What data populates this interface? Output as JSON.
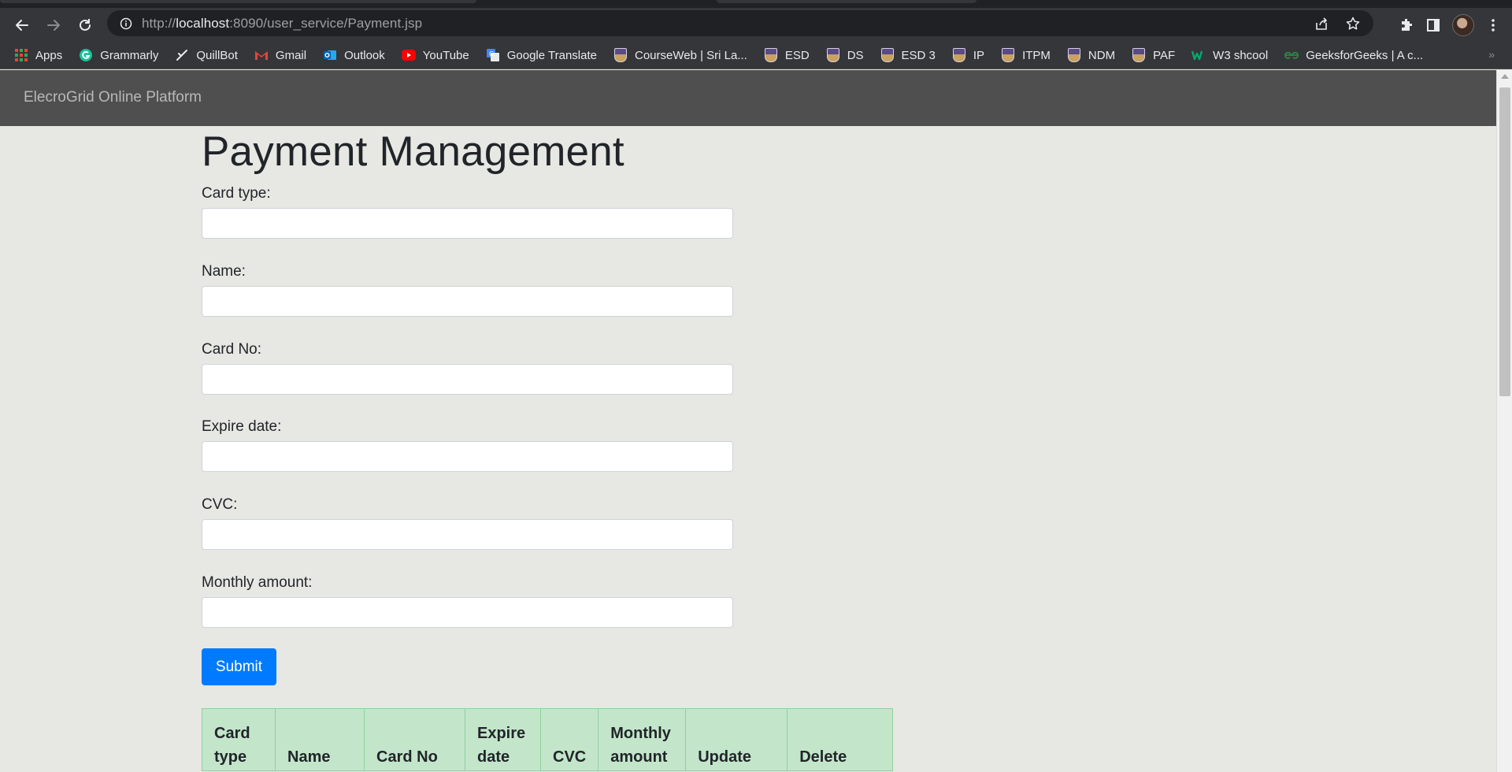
{
  "browser": {
    "url_prefix": "http://",
    "url_host": "localhost",
    "url_rest": ":8090/user_service/Payment.jsp",
    "bookmarks": [
      {
        "label": "Apps",
        "icon": "apps-grid-icon"
      },
      {
        "label": "Grammarly",
        "icon": "grammarly-icon"
      },
      {
        "label": "QuillBot",
        "icon": "quillbot-icon"
      },
      {
        "label": "Gmail",
        "icon": "gmail-icon"
      },
      {
        "label": "Outlook",
        "icon": "outlook-icon"
      },
      {
        "label": "YouTube",
        "icon": "youtube-icon"
      },
      {
        "label": "Google Translate",
        "icon": "google-translate-icon"
      },
      {
        "label": "CourseWeb | Sri La...",
        "icon": "sliit-icon"
      },
      {
        "label": "ESD",
        "icon": "sliit-icon"
      },
      {
        "label": "DS",
        "icon": "sliit-icon"
      },
      {
        "label": "ESD 3",
        "icon": "sliit-icon"
      },
      {
        "label": "IP",
        "icon": "sliit-icon"
      },
      {
        "label": "ITPM",
        "icon": "sliit-icon"
      },
      {
        "label": "NDM",
        "icon": "sliit-icon"
      },
      {
        "label": "PAF",
        "icon": "sliit-icon"
      },
      {
        "label": "W3 shcool",
        "icon": "w3schools-icon"
      },
      {
        "label": "GeeksforGeeks | A c...",
        "icon": "geeksforgeeks-icon"
      }
    ]
  },
  "navbar": {
    "brand": "ElecroGrid Online Platform"
  },
  "page": {
    "title": "Payment Management",
    "fields": [
      {
        "label": "Card type:",
        "value": ""
      },
      {
        "label": "Name:",
        "value": ""
      },
      {
        "label": "Card No:",
        "value": ""
      },
      {
        "label": "Expire date:",
        "value": ""
      },
      {
        "label": "CVC:",
        "value": ""
      },
      {
        "label": "Monthly amount:",
        "value": ""
      }
    ],
    "submit_label": "Submit",
    "table": {
      "headers": [
        "Card type",
        "Name",
        "Card No",
        "Expire date",
        "CVC",
        "Monthly amount",
        "Update",
        "Delete"
      ]
    }
  },
  "colors": {
    "navbar": "#4f4f4f",
    "page_background": "#e7e7e3",
    "primary_button": "#007bff",
    "table_header": "#c3e6cb"
  }
}
